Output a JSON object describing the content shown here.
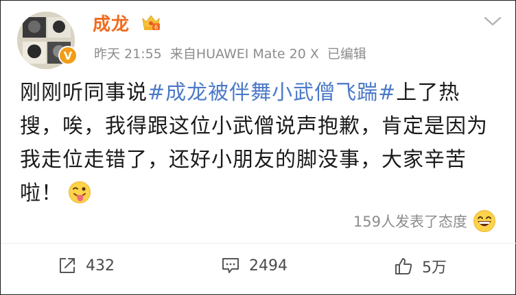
{
  "post": {
    "author": {
      "name": "成龙",
      "verified_badge": "V"
    },
    "meta": {
      "date": "昨天",
      "time": "21:55",
      "source": "来自HUAWEI Mate 20 X",
      "edited": "已编辑"
    },
    "content": {
      "text_before": "刚刚听同事说",
      "hashtag": "#成龙被伴舞小武僧飞踹#",
      "text_after": "上了热搜，唉，我得跟这位小武僧说声抱歉，肯定是因为我走位走错了，还好小朋友的脚没事，大家辛苦啦！",
      "emoji": "tongue-wink-emoji"
    },
    "reactions": {
      "label": "159人发表了态度",
      "emoji": "grin-emoji"
    },
    "actions": {
      "share_count": "432",
      "comment_count": "2494",
      "like_count": "5万"
    }
  },
  "colors": {
    "username": "#f26b1d",
    "hashtag": "#4b79c8",
    "meta": "#8c8c8c",
    "badge": "#f29c18"
  }
}
